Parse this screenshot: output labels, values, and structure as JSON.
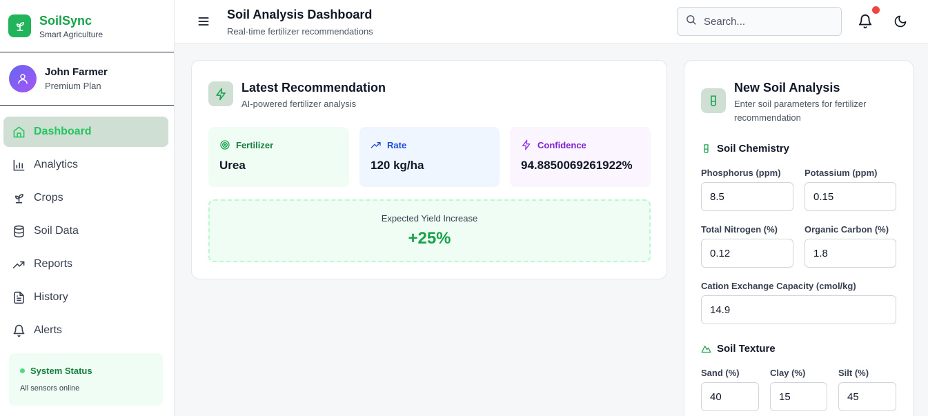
{
  "brand": {
    "name": "SoilSync",
    "tagline": "Smart Agriculture"
  },
  "user": {
    "name": "John Farmer",
    "plan": "Premium Plan"
  },
  "nav": [
    {
      "label": "Dashboard",
      "icon": "home-icon",
      "active": true
    },
    {
      "label": "Analytics",
      "icon": "bar-chart-icon"
    },
    {
      "label": "Crops",
      "icon": "sprout-icon"
    },
    {
      "label": "Soil Data",
      "icon": "database-icon"
    },
    {
      "label": "Reports",
      "icon": "trending-up-icon"
    },
    {
      "label": "History",
      "icon": "document-icon"
    },
    {
      "label": "Alerts",
      "icon": "bell-icon"
    }
  ],
  "system_status": {
    "title": "System Status",
    "text": "All sensors online"
  },
  "header": {
    "title": "Soil Analysis Dashboard",
    "subtitle": "Real-time fertilizer recommendations",
    "search_placeholder": "Search..."
  },
  "recommendation": {
    "title": "Latest Recommendation",
    "subtitle": "AI-powered fertilizer analysis",
    "fertilizer": {
      "label": "Fertilizer",
      "value": "Urea"
    },
    "rate": {
      "label": "Rate",
      "value": "120 kg/ha"
    },
    "confidence": {
      "label": "Confidence",
      "value": "94.8850069261922%"
    },
    "yield": {
      "label": "Expected Yield Increase",
      "value": "+25%"
    }
  },
  "analysis_form": {
    "title": "New Soil Analysis",
    "subtitle": "Enter soil parameters for fertilizer recommendation",
    "chemistry": {
      "title": "Soil Chemistry",
      "phosphorus": {
        "label": "Phosphorus (ppm)",
        "value": "8.5"
      },
      "potassium": {
        "label": "Potassium (ppm)",
        "value": "0.15"
      },
      "nitrogen": {
        "label": "Total Nitrogen (%)",
        "value": "0.12"
      },
      "carbon": {
        "label": "Organic Carbon (%)",
        "value": "1.8"
      },
      "cec": {
        "label": "Cation Exchange Capacity (cmol/kg)",
        "value": "14.9"
      }
    },
    "texture": {
      "title": "Soil Texture",
      "sand": {
        "label": "Sand (%)",
        "value": "40"
      },
      "clay": {
        "label": "Clay (%)",
        "value": "15"
      },
      "silt": {
        "label": "Silt (%)",
        "value": "45"
      }
    }
  },
  "colors": {
    "brand": "#22b45a",
    "accent_green": "#16a34a",
    "active_bg": "#cfdfd3",
    "notification": "#ef4444"
  }
}
